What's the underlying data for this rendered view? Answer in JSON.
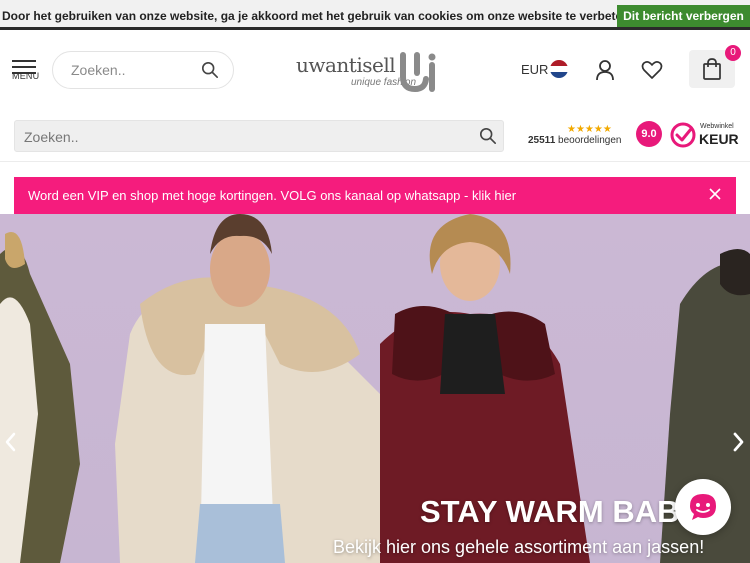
{
  "cookie": {
    "message": "Door het gebruiken van onze website, ga je akkoord met het gebruik van cookies om onze website te verbeteren.",
    "button": "Dit bericht verbergen"
  },
  "header": {
    "menu_label": "MENU",
    "search_placeholder": "Zoeken..",
    "logo_name": "uwantisell",
    "logo_sub": "unique fashion",
    "currency": "EUR",
    "cart_count": "0"
  },
  "second_row": {
    "search_placeholder": "Zoeken..",
    "stars": "★★★★★",
    "review_count": "25511",
    "review_label": "beoordelingen",
    "score": "9.0",
    "keur_small": "Webwinkel",
    "keur_big": "KEUR"
  },
  "vip_bar": {
    "text": "Word een VIP en shop met hoge kortingen. VOLG ons kanaal op whatsapp - klik hier"
  },
  "hero": {
    "title": "STAY WARM BABE",
    "subtitle": "Bekijk hier ons gehele assortiment aan jassen!"
  },
  "icons": {
    "menu": "hamburger-icon",
    "search": "search-icon",
    "flag": "netherlands-flag-icon",
    "account": "user-icon",
    "wishlist": "heart-icon",
    "cart": "shopping-bag-icon",
    "close": "close-icon",
    "chat": "chat-icon"
  },
  "colors": {
    "accent_pink": "#f51c7d",
    "cookie_button": "#3d8b2f",
    "badge": "#e8197a",
    "stars": "#f2a900"
  }
}
